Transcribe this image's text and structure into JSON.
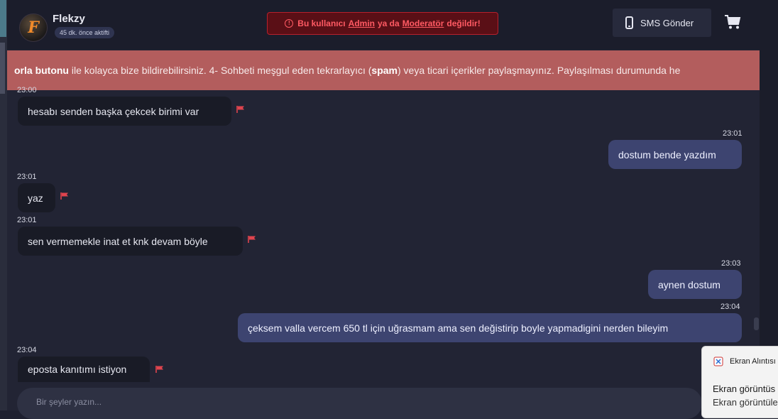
{
  "user": {
    "name": "Flekzy",
    "status": "45 dk. önce aktifti",
    "avatar_letter": "F"
  },
  "warning": {
    "pre": "Bu kullanıcı",
    "admin": "Admin",
    "mid": "ya da",
    "moderator": "Moderatör",
    "post": "değildir!"
  },
  "header": {
    "sms_label": "SMS Gönder"
  },
  "banner": {
    "bold1": "orla butonu",
    "text1": " ile kolayca bize bildirebilirsiniz. 4- Sohbeti meşgul eden tekrarlayıcı (",
    "bold2": "spam",
    "text2": ") veya ticari içerikler paylaşmayınız. Paylaşılması durumunda he"
  },
  "messages": [
    {
      "time": "23:00",
      "text": "hesabı senden başka çekcek birimi var",
      "dir": "in"
    },
    {
      "time": "23:01",
      "text": "dostum bende yazdım",
      "dir": "out"
    },
    {
      "time": "23:01",
      "text": "yaz",
      "dir": "in"
    },
    {
      "time": "23:01",
      "text": "sen vermemekle inat et knk devam böyle",
      "dir": "in"
    },
    {
      "time": "23:03",
      "text": "aynen dostum",
      "dir": "out"
    },
    {
      "time": "23:04",
      "text": "çeksem valla vercem 650 tl için uğrasmam ama sen değistirip boyle yapmadigini nerden bileyim",
      "dir": "out"
    },
    {
      "time": "23:04",
      "text": "eposta kanıtımı istiyon",
      "dir": "in"
    }
  ],
  "composer": {
    "placeholder": "Bir şeyler yazın..."
  },
  "toast": {
    "app": "Ekran Alıntısı",
    "title": "Ekran görüntüs",
    "body": "Ekran görüntüle"
  },
  "colors": {
    "flag": "#e0444e",
    "outgoing_bubble": "#3d4470",
    "banner": "#b35d5d",
    "warning": "#ff5a63"
  }
}
